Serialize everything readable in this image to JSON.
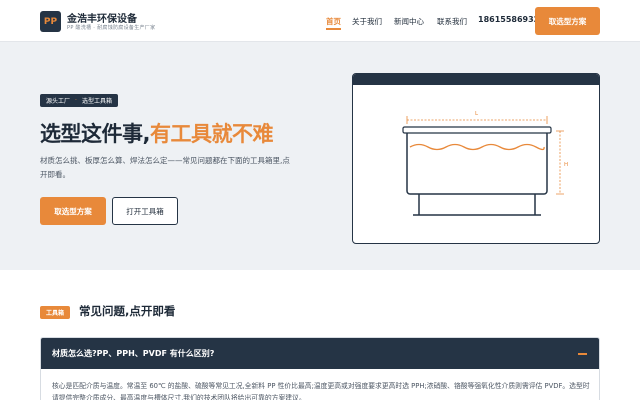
{
  "brand": {
    "logo": "PP",
    "name": "金浩丰环保设备",
    "subtitle": "PP 酸洗槽 · 耐腐蚀防腐设备生产厂家"
  },
  "nav": {
    "items": [
      "首页",
      "关于我们",
      "新闻中心",
      "联系我们"
    ],
    "active_index": 0,
    "phone": "18615586932",
    "cta": "取选型方案"
  },
  "hero": {
    "breadcrumb": [
      "源头工厂",
      "选型工具箱"
    ],
    "title_main": "选型这件事,",
    "title_accent": "有工具就不难",
    "description": "材质怎么挑、板厚怎么算、焊法怎么定——常见问题都在下面的工具箱里,点开即看。",
    "primary_button": "取选型方案",
    "secondary_button": "打开工具箱"
  },
  "illustration": {
    "length_label": "L",
    "height_label": "H",
    "accent_color": "#e8893a",
    "line_color": "#253445"
  },
  "faq": {
    "tag": "工具箱",
    "title": "常见问题,点开即看",
    "question": "材质怎么选?PP、PPH、PVDF 有什么区别?",
    "answer": "核心是匹配介质与温度。常温至 60℃ 的盐酸、硫酸等常见工况,全新料 PP 性价比最高;温度更高或对强度要求更高时选 PPH;浓硝酸、铬酸等强氧化性介质则需评估 PVDF。选型时请提供完整介质成分、最高温度与槽体尺寸,我们的技术团队将给出可靠的方案建议。"
  },
  "colors": {
    "accent": "#e8893a",
    "navy": "#253445"
  }
}
